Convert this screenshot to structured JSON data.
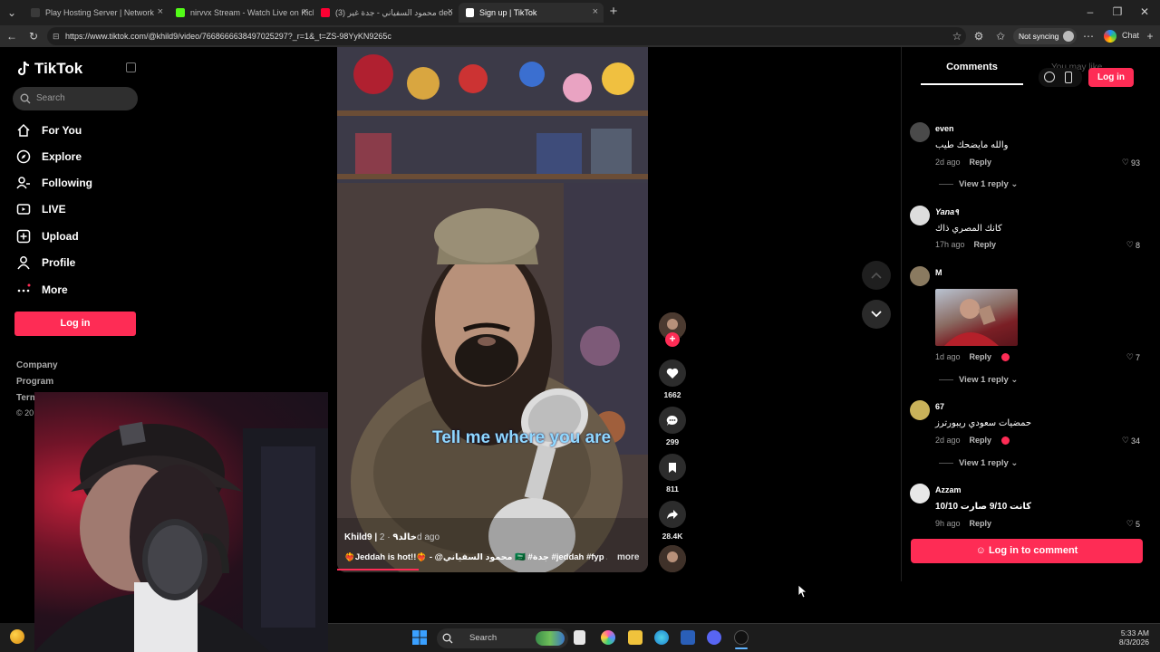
{
  "browser": {
    "tabs": [
      {
        "title": "Play Hosting Server | Network",
        "favicon_color": "#3a3a3a"
      },
      {
        "title": "nirvvx Stream - Watch Live on Kick",
        "favicon_color": "#53fc18"
      },
      {
        "title": "محمود السفياني - جدة غير (3) deo",
        "favicon_color": "#ff0033"
      },
      {
        "title": "Sign up | TikTok",
        "favicon_color": "#ffffff"
      }
    ],
    "url": "https://www.tiktok.com/@khild9/video/7668666638497025297?_r=1&_t=ZS-98YyKN9265c",
    "sync_label": "Not syncing",
    "chat_label": "Chat"
  },
  "sidebar": {
    "logo": "TikTok",
    "search_placeholder": "Search",
    "nav": [
      {
        "label": "For You",
        "icon": "home-icon"
      },
      {
        "label": "Explore",
        "icon": "compass-icon"
      },
      {
        "label": "Following",
        "icon": "following-icon"
      },
      {
        "label": "LIVE",
        "icon": "live-icon"
      },
      {
        "label": "Upload",
        "icon": "upload-icon"
      },
      {
        "label": "Profile",
        "icon": "profile-icon"
      },
      {
        "label": "More",
        "icon": "more-icon"
      }
    ],
    "login_label": "Log in",
    "footer": [
      "Company",
      "Program",
      "Term",
      "© 20"
    ]
  },
  "video": {
    "caption": "Tell me where you are",
    "author": "Khild9 | خالد٩",
    "posted": "· 2d ago",
    "description": "❤️‍🔥Jeddah is hot!!❤️‍🔥 - @محمود السفياني 🇸🇦 #جدة #jeddah #fyp ...",
    "more_label": "more"
  },
  "actions": {
    "likes": "1662",
    "comments": "299",
    "saves": "811",
    "shares": "28.4K"
  },
  "comments_panel": {
    "tab_comments": "Comments",
    "tab_may_like": "You may like",
    "login_label": "Log in",
    "reply_label": "Reply",
    "items": [
      {
        "user": "even",
        "text": "والله مايضحك طيب",
        "time": "2d ago",
        "likes": "93",
        "view_replies": "View 1 reply",
        "avatar_color": "#4a4a4a"
      },
      {
        "user": "Yana٩",
        "text": "كانك المصري ذاك",
        "time": "17h ago",
        "likes": "8",
        "avatar_color": "#dddddd"
      },
      {
        "user": "M",
        "text": "",
        "time": "1d ago",
        "likes": "7",
        "view_replies": "View 1 reply",
        "avatar_color": "#8a7a60"
      },
      {
        "user": "67",
        "text": "حمضيات سعودي ريبورترز",
        "time": "2d ago",
        "likes": "34",
        "view_replies": "View 1 reply",
        "avatar_color": "#c9b25a"
      },
      {
        "user": "Azzam",
        "text": "كانت 9/10 صارت 10/10",
        "time": "9h ago",
        "likes": "5",
        "avatar_color": "#e8e8e8"
      }
    ],
    "login_to_comment": "Log in to comment"
  },
  "taskbar": {
    "search_placeholder": "Search",
    "time": "5:33 AM",
    "date": "8/3/2026"
  }
}
